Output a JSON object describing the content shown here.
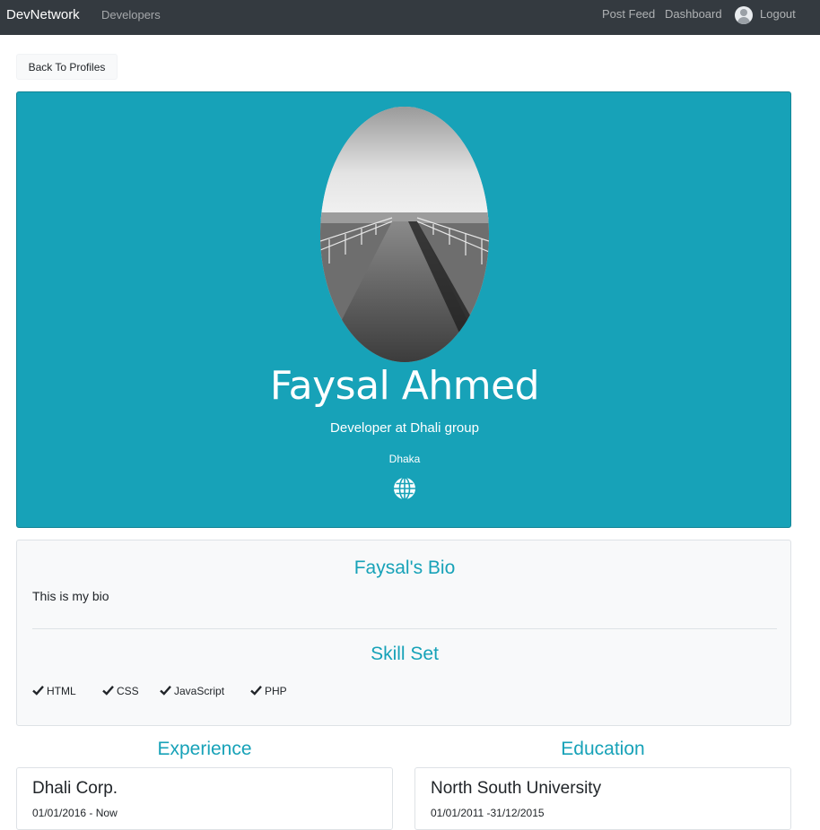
{
  "navbar": {
    "brand": "DevNetwork",
    "developers": "Developers",
    "post_feed": "Post Feed",
    "dashboard": "Dashboard",
    "logout": "Logout",
    "bg_color": "#343a40"
  },
  "back_button": {
    "label": "Back To Profiles"
  },
  "profile": {
    "name": "Faysal Ahmed",
    "title": "Developer at Dhali group",
    "location": "Dhaka",
    "website_icon": "globe-icon",
    "hero_color": "#17a2b8"
  },
  "bio": {
    "heading": "Faysal's Bio",
    "text": "This is my bio"
  },
  "skills": {
    "heading": "Skill Set",
    "items": [
      "HTML",
      "CSS",
      "JavaScript",
      "PHP"
    ]
  },
  "experience": {
    "heading": "Experience",
    "items": [
      {
        "company": "Dhali Corp.",
        "dates": "01/01/2016 - Now"
      }
    ]
  },
  "education": {
    "heading": "Education",
    "items": [
      {
        "school": "North South University",
        "dates": "01/01/2011 -31/12/2015"
      }
    ]
  }
}
